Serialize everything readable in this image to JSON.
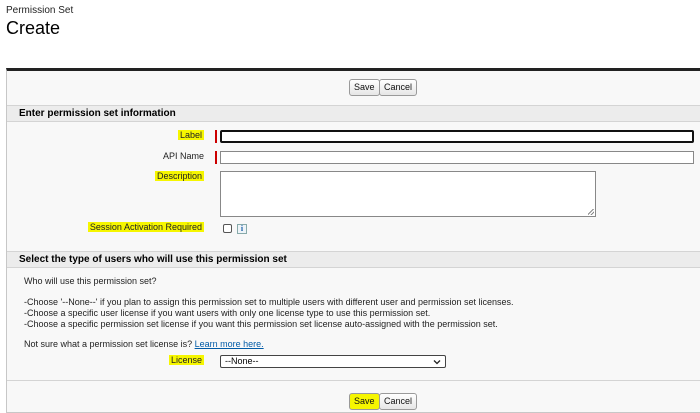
{
  "header": {
    "page_type": "Permission Set",
    "title": "Create"
  },
  "top_buttons": {
    "save": "Save",
    "cancel": "Cancel"
  },
  "section1": {
    "title": "Enter permission set information",
    "label_field": {
      "label": "Label",
      "value": ""
    },
    "api_name_field": {
      "label": "API Name",
      "value": ""
    },
    "description_field": {
      "label": "Description",
      "value": ""
    },
    "session_field": {
      "label": "Session Activation Required",
      "info": "i"
    }
  },
  "section2": {
    "title": "Select the type of users who will use this permission set",
    "question": "Who will use this permission set?",
    "lines": [
      "-Choose '--None--' if you plan to assign this permission set to multiple users with different user and permission set licenses.",
      "-Choose a specific user license if you want users with only one license type to use this permission set.",
      "-Choose a specific permission set license if you want this permission set license auto-assigned with the permission set."
    ],
    "not_sure": "Not sure what a permission set license is?",
    "learn_more": "Learn more here.",
    "license_field": {
      "label": "License",
      "selected": "--None--"
    }
  },
  "bottom_buttons": {
    "save": "Save",
    "cancel": "Cancel"
  },
  "colors": {
    "highlight": "#f6f600",
    "required": "#cc0000",
    "link": "#015ba7"
  }
}
